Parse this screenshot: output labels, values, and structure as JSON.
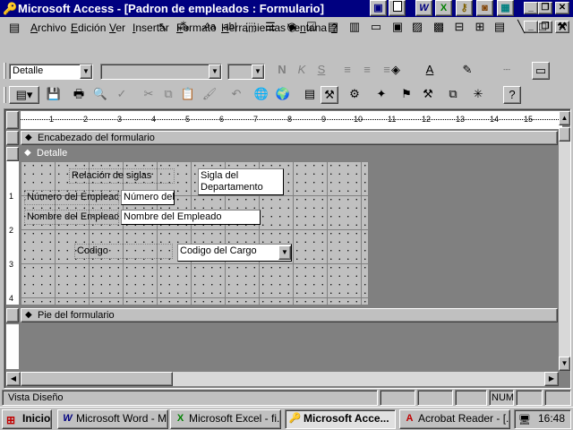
{
  "title_bar": {
    "text": "Microsoft Access - [Padron de empleados : Formulario]"
  },
  "menu": {
    "items": [
      {
        "pre": "",
        "acc": "A",
        "post": "rchivo"
      },
      {
        "pre": "",
        "acc": "E",
        "post": "dición"
      },
      {
        "pre": "",
        "acc": "V",
        "post": "er"
      },
      {
        "pre": "",
        "acc": "I",
        "post": "nsertar"
      },
      {
        "pre": "",
        "acc": "F",
        "post": "ormato"
      },
      {
        "pre": "",
        "acc": "H",
        "post": "erramientas"
      },
      {
        "pre": "Ve",
        "acc": "n",
        "post": "tana"
      },
      {
        "pre": "",
        "acc": "?",
        "post": ""
      }
    ]
  },
  "format_toolbar": {
    "object_combo": "Detalle",
    "font_combo": "",
    "size_combo": ""
  },
  "ruler": {
    "ticks": [
      "1",
      "2",
      "3",
      "4",
      "5",
      "6",
      "7",
      "8",
      "9",
      "10",
      "11",
      "12",
      "13",
      "14",
      "15"
    ]
  },
  "sections": {
    "header": "Encabezado del formulario",
    "detail": "Detalle",
    "footer": "Pie del formulario"
  },
  "vertical_ruler": [
    "1",
    "2",
    "3",
    "4"
  ],
  "controls": {
    "rel_label": "Relación de siglas",
    "sigla_box": "Sigla del Departamento",
    "num_label": "Número del Empleado",
    "num_field": "Número del",
    "nombre_label": "Nombre del Empleado",
    "nombre_field": "Nombre del Empleado",
    "codigo_label": "Codigo",
    "codigo_combo": "Codigo del Cargo"
  },
  "status_bar": {
    "text": "Vista Diseño",
    "num": "NUM"
  },
  "taskbar": {
    "start": "Inicio",
    "buttons": [
      {
        "label": "Microsoft Word - M...",
        "icon": "W",
        "active": false
      },
      {
        "label": "Microsoft Excel - fi...",
        "icon": "X",
        "active": false
      },
      {
        "label": "Microsoft Acce...",
        "icon": "🔑",
        "active": true
      },
      {
        "label": "Acrobat Reader - [...",
        "icon": "A",
        "active": false
      }
    ],
    "clock": "16:48"
  }
}
